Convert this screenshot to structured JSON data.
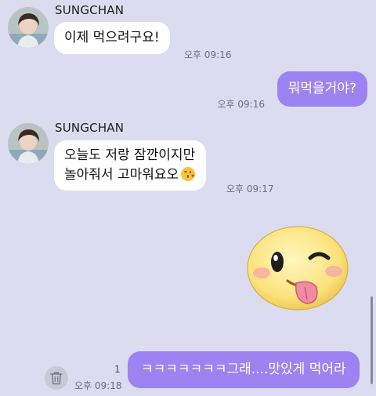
{
  "messages": [
    {
      "sender": "SUNGCHAN",
      "text": "이제 먹으려구요!",
      "time": "오후 09:16"
    },
    {
      "mine": true,
      "text": "뭐먹을거야?",
      "time": "오후 09:16"
    },
    {
      "sender": "SUNGCHAN",
      "line1": "오늘도 저랑 잠깐이지만",
      "line2": "놀아줘서 고마워요오",
      "emoji": "kissing-face-with-heart-emoji",
      "time": "오후 09:17"
    },
    {
      "sticker": "winking-tongue-face-sticker"
    },
    {
      "mine": true,
      "text": "ㅋㅋㅋㅋㅋㅋㅋ그래....맛있게 먹어라",
      "time": "오후 09:18",
      "unread_count": "1"
    }
  ],
  "colors": {
    "background": "#dcdcf1",
    "incoming_bubble": "#ffffff",
    "outgoing_bubble": "#9d83f1"
  },
  "icons": {
    "delete": "trash-icon"
  }
}
